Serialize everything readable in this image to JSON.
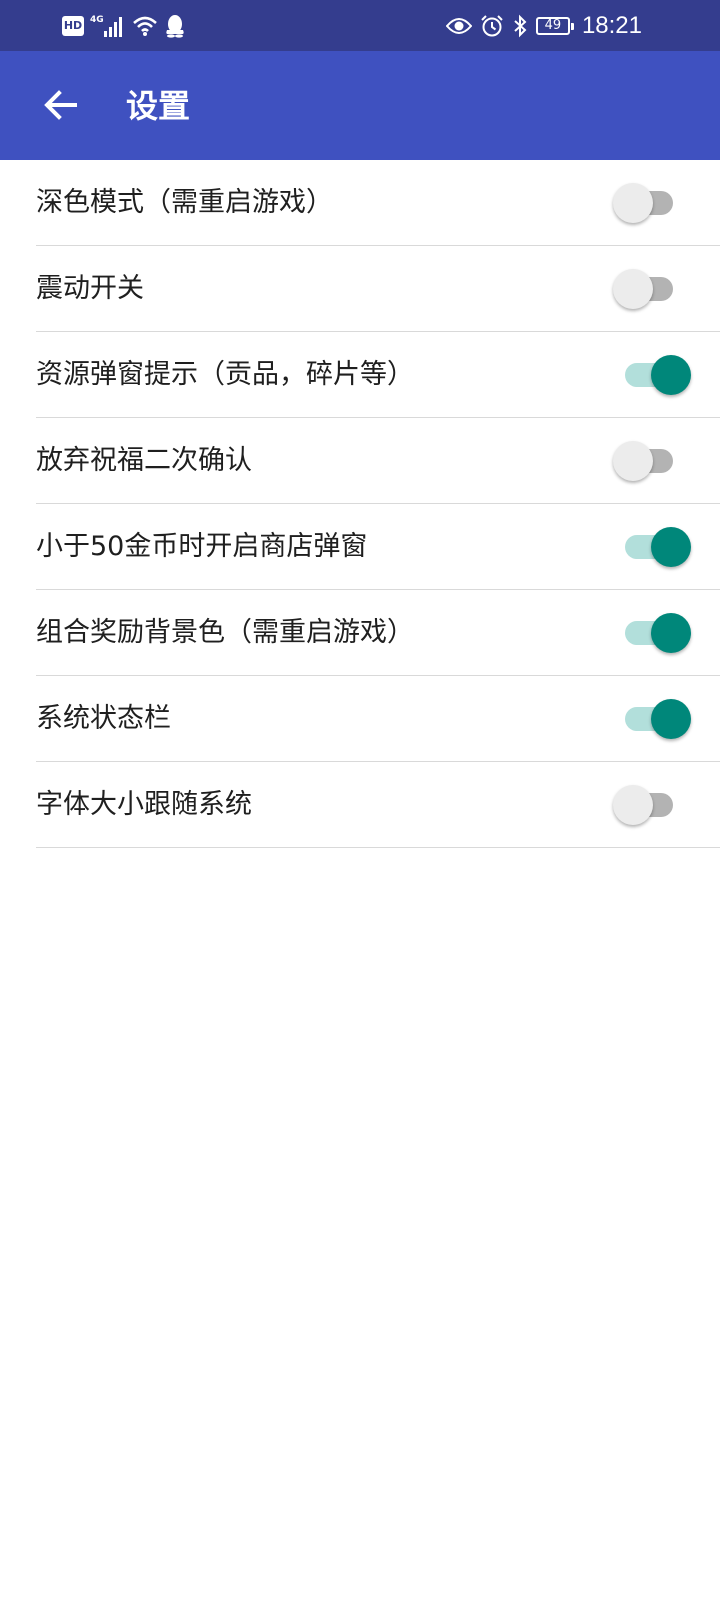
{
  "status_bar": {
    "hd_label": "HD",
    "signal_label": "4G",
    "battery_level": "49",
    "time": "18:21"
  },
  "app_bar": {
    "title": "设置"
  },
  "settings": [
    {
      "label": "深色模式（需重启游戏）",
      "on": false
    },
    {
      "label": "震动开关",
      "on": false
    },
    {
      "label": "资源弹窗提示（贡品，碎片等）",
      "on": true
    },
    {
      "label": "放弃祝福二次确认",
      "on": false
    },
    {
      "label": "小于50金币时开启商店弹窗",
      "on": true
    },
    {
      "label": "组合奖励背景色（需重启游戏）",
      "on": true
    },
    {
      "label": "系统状态栏",
      "on": true
    },
    {
      "label": "字体大小跟随系统",
      "on": false
    }
  ],
  "colors": {
    "status_bar": "#343d8e",
    "app_bar": "#3f51c0",
    "switch_on_thumb": "#00877a",
    "switch_on_track": "#b2dfdb",
    "switch_off_thumb": "#ececec",
    "switch_off_track": "#b3b3b3"
  },
  "icons": {
    "back": "arrow-left-icon",
    "status_left": [
      "hd-icon",
      "4g-signal-icon",
      "wifi-icon",
      "qq-icon"
    ],
    "status_right": [
      "eye-icon",
      "alarm-icon",
      "bluetooth-icon",
      "battery-icon"
    ]
  }
}
